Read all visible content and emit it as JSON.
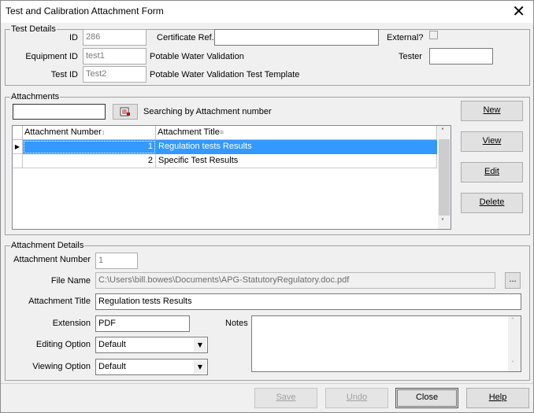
{
  "window": {
    "title": "Test and Calibration Attachment Form",
    "close_glyph": "✕"
  },
  "test_details": {
    "legend": "Test Details",
    "id_label": "ID",
    "id_value": "286",
    "certificate_label": "Certificate Ref.",
    "certificate_value": "",
    "external_label": "External?",
    "equipment_id_label": "Equipment ID",
    "equipment_id_value": "test1",
    "equipment_desc": "Potable Water Validation",
    "tester_label": "Tester",
    "tester_value": "",
    "test_id_label": "Test ID",
    "test_id_value": "Test2",
    "test_desc": "Potable Water Validation Test Template"
  },
  "attachments": {
    "legend": "Attachments",
    "search_value": "",
    "search_status": "Searching by Attachment number",
    "columns": [
      {
        "label": "Attachment Number",
        "sort_glyph": "↕"
      },
      {
        "label": "Attachment Title",
        "sort_glyph": "≡"
      }
    ],
    "rows": [
      {
        "number": "1",
        "title": "Regulation tests Results",
        "selected": true
      },
      {
        "number": "2",
        "title": "Specific Test Results",
        "selected": false
      }
    ],
    "row_indicator": "▶",
    "buttons": {
      "new": "New",
      "view": "View",
      "edit": "Edit",
      "delete": "Delete"
    }
  },
  "attachment_details": {
    "legend": "Attachment Details",
    "number_label": "Attachment Number",
    "number_value": "1",
    "file_name_label": "File Name",
    "file_name_value": "C:\\Users\\bill.bowes\\Documents\\APG-StatutoryRegulatory.doc.pdf",
    "browse_label": "...",
    "title_label": "Attachment Title",
    "title_value": "Regulation tests Results",
    "extension_label": "Extension",
    "extension_value": "PDF",
    "notes_label": "Notes",
    "notes_value": "",
    "editing_label": "Editing Option",
    "editing_value": "Default",
    "viewing_label": "Viewing Option",
    "viewing_value": "Default"
  },
  "footer": {
    "save": "Save",
    "undo": "Undo",
    "close": "Close",
    "help": "Help"
  },
  "colors": {
    "selection": "#3399ff",
    "focus": "#0078d7",
    "background": "#f0f0f0"
  }
}
